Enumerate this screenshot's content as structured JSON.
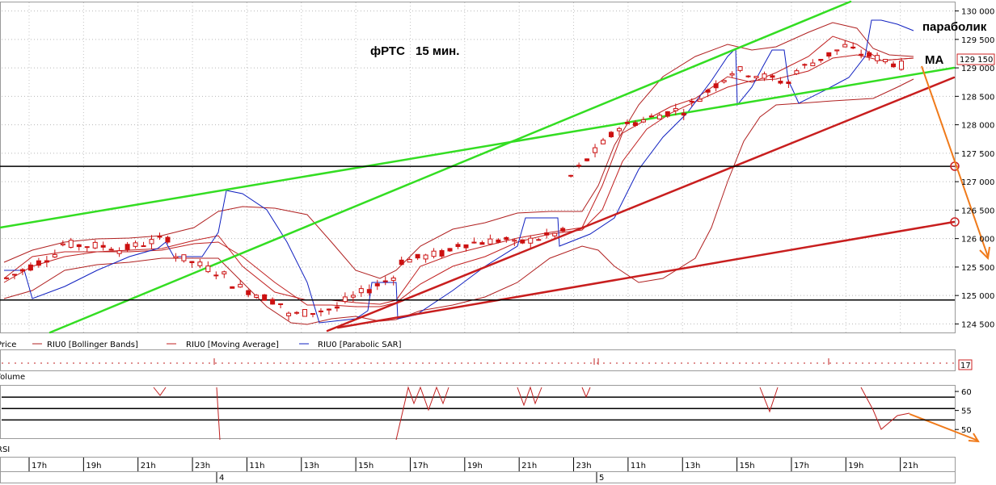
{
  "chart_data": {
    "type": "candlestick",
    "title": "фРТС",
    "timeframe_label": "15 мин.",
    "annotations": {
      "parabolic_label": "параболик",
      "ma_label": "МА"
    },
    "price_axis": {
      "ticks": [
        130000,
        129500,
        129000,
        128500,
        128000,
        127500,
        127000,
        126500,
        126000,
        125500,
        125000,
        124500
      ],
      "tick_labels": [
        "130 000",
        "129 500",
        "129 000",
        "128 500",
        "128 000",
        "127 500",
        "127 000",
        "126 500",
        "126 000",
        "125 500",
        "125 000",
        "124 500"
      ],
      "ylim": [
        124350,
        130150
      ],
      "last_price_label": "129 150",
      "last_price": 129150
    },
    "horizontal_levels": [
      127270,
      124920
    ],
    "legend": [
      "Price",
      "RIU0 [Bollinger Bands]",
      "RIU0 [Moving Average]",
      "RIU0 [Parabolic SAR]"
    ],
    "volume_panel": {
      "label": "Volume",
      "last_value": "17"
    },
    "rsi_panel": {
      "label": "RSI",
      "ticks": [
        60,
        55,
        50
      ],
      "tick_labels": [
        "60",
        "55",
        "50"
      ],
      "levels": [
        58.5,
        55.5,
        52.5
      ]
    },
    "time_axis": {
      "labels": [
        "17h",
        "19h",
        "21h",
        "23h",
        "11h",
        "13h",
        "15h",
        "17h",
        "19h",
        "21h",
        "23h",
        "11h",
        "13h",
        "15h",
        "17h",
        "19h",
        "21h"
      ],
      "day_labels": [
        "4",
        "5"
      ]
    },
    "candles_approx": [
      {
        "t": "17h",
        "o": 125100,
        "h": 125400,
        "c": 125300,
        "l": 125000
      },
      {
        "t": "19h",
        "o": 125800,
        "h": 126000,
        "c": 125900,
        "l": 125650
      },
      {
        "t": "21h",
        "o": 125850,
        "h": 125950,
        "c": 125800,
        "l": 125700
      },
      {
        "t": "23h",
        "o": 126050,
        "h": 126500,
        "c": 125700,
        "l": 125550
      },
      {
        "t": "11h",
        "o": 125300,
        "h": 125500,
        "c": 125200,
        "l": 124900
      },
      {
        "t": "13h",
        "o": 124800,
        "h": 125100,
        "c": 124650,
        "l": 124450
      },
      {
        "t": "15h",
        "o": 124800,
        "h": 125050,
        "c": 124900,
        "l": 124650
      },
      {
        "t": "17h",
        "o": 125400,
        "h": 125700,
        "c": 125600,
        "l": 125250
      },
      {
        "t": "19h",
        "o": 125800,
        "h": 126100,
        "c": 125900,
        "l": 125650
      },
      {
        "t": "21h",
        "o": 126000,
        "h": 126200,
        "c": 125900,
        "l": 125750
      },
      {
        "t": "23h",
        "o": 126150,
        "h": 127000,
        "c": 127100,
        "l": 126050
      },
      {
        "t": "11h",
        "o": 128100,
        "h": 128350,
        "c": 128000,
        "l": 127700
      },
      {
        "t": "13h",
        "o": 128300,
        "h": 128500,
        "c": 128250,
        "l": 128100
      },
      {
        "t": "15h",
        "o": 129050,
        "h": 129300,
        "c": 128950,
        "l": 128800
      },
      {
        "t": "17h",
        "o": 128700,
        "h": 129150,
        "c": 128950,
        "l": 128450
      },
      {
        "t": "19h",
        "o": 129450,
        "h": 129700,
        "c": 129300,
        "l": 129100
      },
      {
        "t": "21h",
        "o": 129000,
        "h": 129200,
        "c": 129150,
        "l": 128950
      }
    ],
    "colors": {
      "bull_candle": "#cc1111",
      "bear_candle": "#cc1111",
      "bollinger": "#b02020",
      "moving_average": "#c02020",
      "parabolic_sar": "#1020c0",
      "trend_green": "#33dd22",
      "trend_red": "#c81e1e",
      "forecast_arrow": "#f07a1a",
      "level_line": "#000000",
      "price_tag_border": "#cc2222"
    }
  }
}
